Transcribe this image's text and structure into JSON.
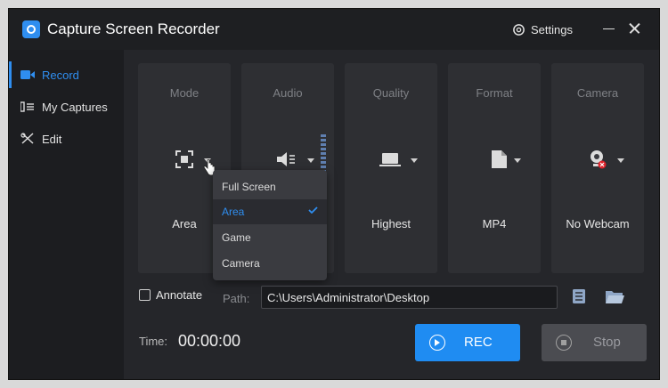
{
  "app": {
    "title": "Capture Screen Recorder",
    "settings_label": "Settings",
    "icons": {
      "logo": "camera-logo-icon",
      "settings": "gear-icon",
      "minimize": "minimize-icon",
      "close": "close-icon"
    }
  },
  "sidebar": {
    "items": [
      {
        "label": "Record",
        "icon": "video-camera-icon",
        "active": true
      },
      {
        "label": "My Captures",
        "icon": "list-icon",
        "active": false
      },
      {
        "label": "Edit",
        "icon": "edit-tools-icon",
        "active": false
      }
    ]
  },
  "panels": [
    {
      "title": "Mode",
      "value": "Area",
      "icon": "area-select-icon"
    },
    {
      "title": "Audio",
      "value": "",
      "icon": "speaker-icon"
    },
    {
      "title": "Quality",
      "value": "Highest",
      "icon": "laptop-icon"
    },
    {
      "title": "Format",
      "value": "MP4",
      "icon": "file-icon"
    },
    {
      "title": "Camera",
      "value": "No Webcam",
      "icon": "webcam-off-icon"
    }
  ],
  "mode_dropdown": {
    "options": [
      "Full Screen",
      "Area",
      "Game",
      "Camera"
    ],
    "selected": "Area"
  },
  "annotate": {
    "label": "Annotate",
    "checked": false
  },
  "path": {
    "label": "Path:",
    "value": "C:\\Users\\Administrator\\Desktop"
  },
  "time": {
    "label": "Time:",
    "value": "00:00:00"
  },
  "buttons": {
    "rec": "REC",
    "stop": "Stop"
  },
  "colors": {
    "accent": "#1f8cf2",
    "background": "#25262a",
    "panel": "#2e2f33",
    "sidebar": "#1c1d20"
  }
}
